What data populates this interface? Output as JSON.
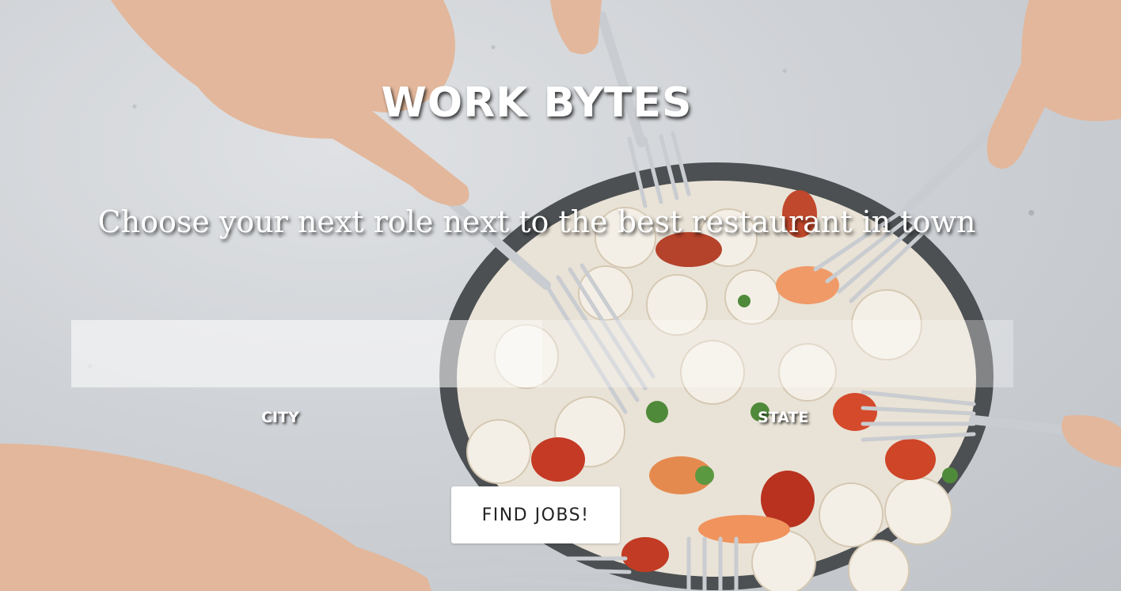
{
  "hero": {
    "title": "WORK BYTES",
    "tagline": "Choose your next role next to the best restaurant in town",
    "background_image": "food-plate-with-forks-on-concrete"
  },
  "search": {
    "city_label": "CITY",
    "state_label": "STATE",
    "city_value": "",
    "state_value": "",
    "submit_label": "FIND JOBS!"
  },
  "colors": {
    "text": "#ffffff",
    "button_bg": "#ffffff",
    "button_text": "#222222"
  }
}
